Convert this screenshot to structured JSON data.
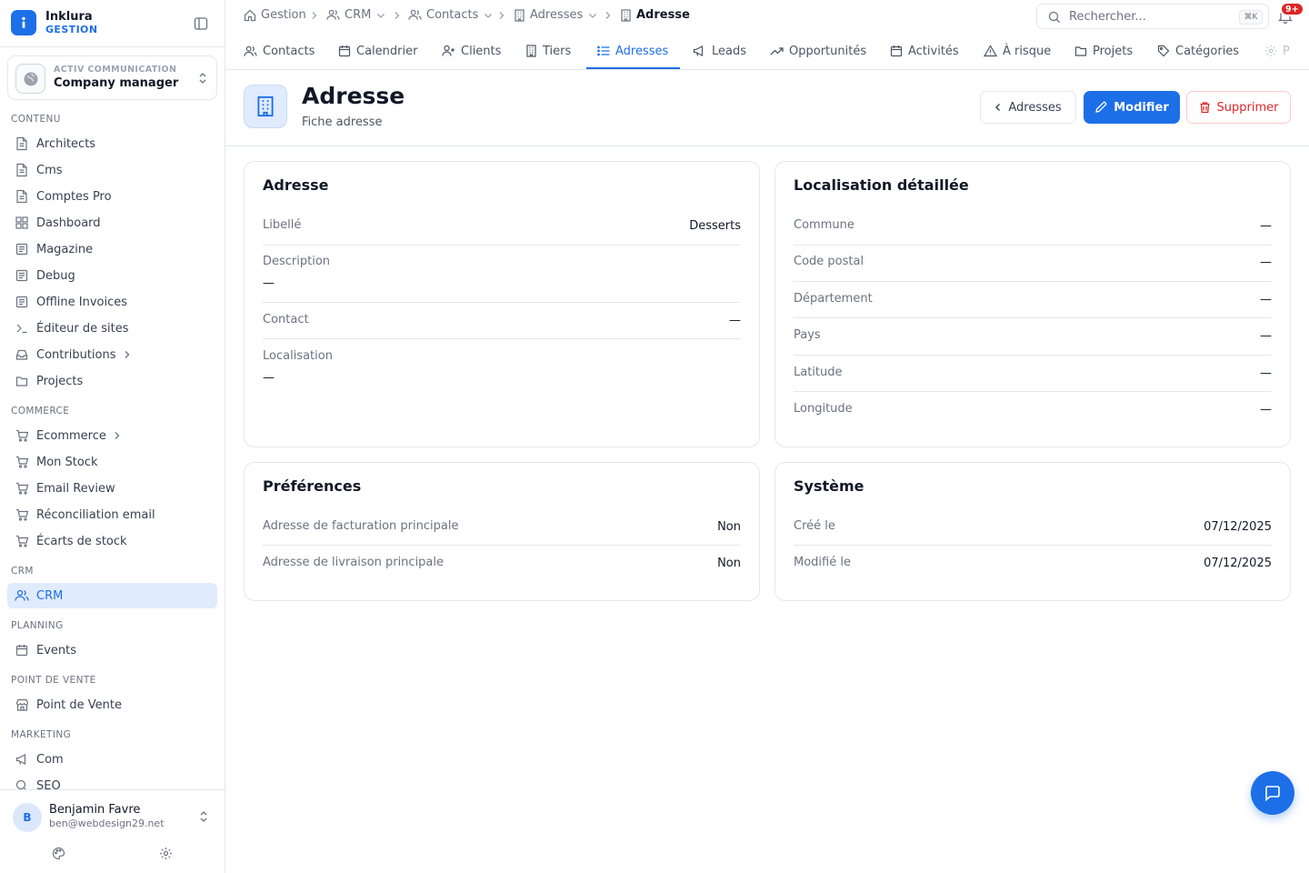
{
  "brand": {
    "name": "Inklura",
    "sub": "GESTION"
  },
  "org": {
    "kicker": "ACTIV COMMUNICATION",
    "name": "Company manager"
  },
  "nav": {
    "sections": {
      "contenu": "CONTENU",
      "commerce": "COMMERCE",
      "crm": "CRM",
      "planning": "PLANNING",
      "pos": "POINT DE VENTE",
      "marketing": "MARKETING"
    },
    "items": {
      "architects": "Architects",
      "cms": "Cms",
      "comptes_pro": "Comptes Pro",
      "dashboard": "Dashboard",
      "magazine": "Magazine",
      "debug": "Debug",
      "offline_invoices": "Offline Invoices",
      "editeur_sites": "Éditeur de sites",
      "contributions": "Contributions",
      "projects": "Projects",
      "ecommerce": "Ecommerce",
      "mon_stock": "Mon Stock",
      "email_review": "Email Review",
      "reconciliation": "Réconciliation email",
      "ecarts_stock": "Écarts de stock",
      "crm": "CRM",
      "events": "Events",
      "point_de_vente": "Point de Vente",
      "com": "Com",
      "seo": "SEO"
    }
  },
  "user": {
    "initial": "B",
    "name": "Benjamin Favre",
    "email": "ben@webdesign29.net"
  },
  "breadcrumb": {
    "gestion": "Gestion",
    "crm": "CRM",
    "contacts": "Contacts",
    "adresses": "Adresses",
    "current": "Adresse"
  },
  "search": {
    "placeholder": "Rechercher...",
    "shortcut": "⌘K"
  },
  "notifications": {
    "badge": "9+"
  },
  "tabs": {
    "contacts": "Contacts",
    "calendrier": "Calendrier",
    "clients": "Clients",
    "tiers": "Tiers",
    "adresses": "Adresses",
    "leads": "Leads",
    "opportunites": "Opportunités",
    "activites": "Activités",
    "a_risque": "À risque",
    "projets": "Projets",
    "categories": "Catégories",
    "more": "P"
  },
  "page": {
    "title": "Adresse",
    "subtitle": "Fiche adresse",
    "back_label": "Adresses",
    "edit_label": "Modifier",
    "delete_label": "Supprimer"
  },
  "cards": {
    "adresse": {
      "title": "Adresse",
      "libelle_label": "Libellé",
      "libelle_value": "Desserts",
      "description_label": "Description",
      "description_value": "—",
      "contact_label": "Contact",
      "contact_value": "—",
      "localisation_label": "Localisation",
      "localisation_value": "—"
    },
    "localisation": {
      "title": "Localisation détaillée",
      "commune_label": "Commune",
      "commune_value": "—",
      "code_postal_label": "Code postal",
      "code_postal_value": "—",
      "departement_label": "Département",
      "departement_value": "—",
      "pays_label": "Pays",
      "pays_value": "—",
      "latitude_label": "Latitude",
      "latitude_value": "—",
      "longitude_label": "Longitude",
      "longitude_value": "—"
    },
    "preferences": {
      "title": "Préférences",
      "facturation_label": "Adresse de facturation principale",
      "facturation_value": "Non",
      "livraison_label": "Adresse de livraison principale",
      "livraison_value": "Non"
    },
    "systeme": {
      "title": "Système",
      "cree_label": "Créé le",
      "cree_value": "07/12/2025",
      "modifie_label": "Modifié le",
      "modifie_value": "07/12/2025"
    }
  },
  "colors": {
    "accent": "#1d6fe8",
    "danger": "#dc2626",
    "active_bg": "#e0ebfd"
  }
}
